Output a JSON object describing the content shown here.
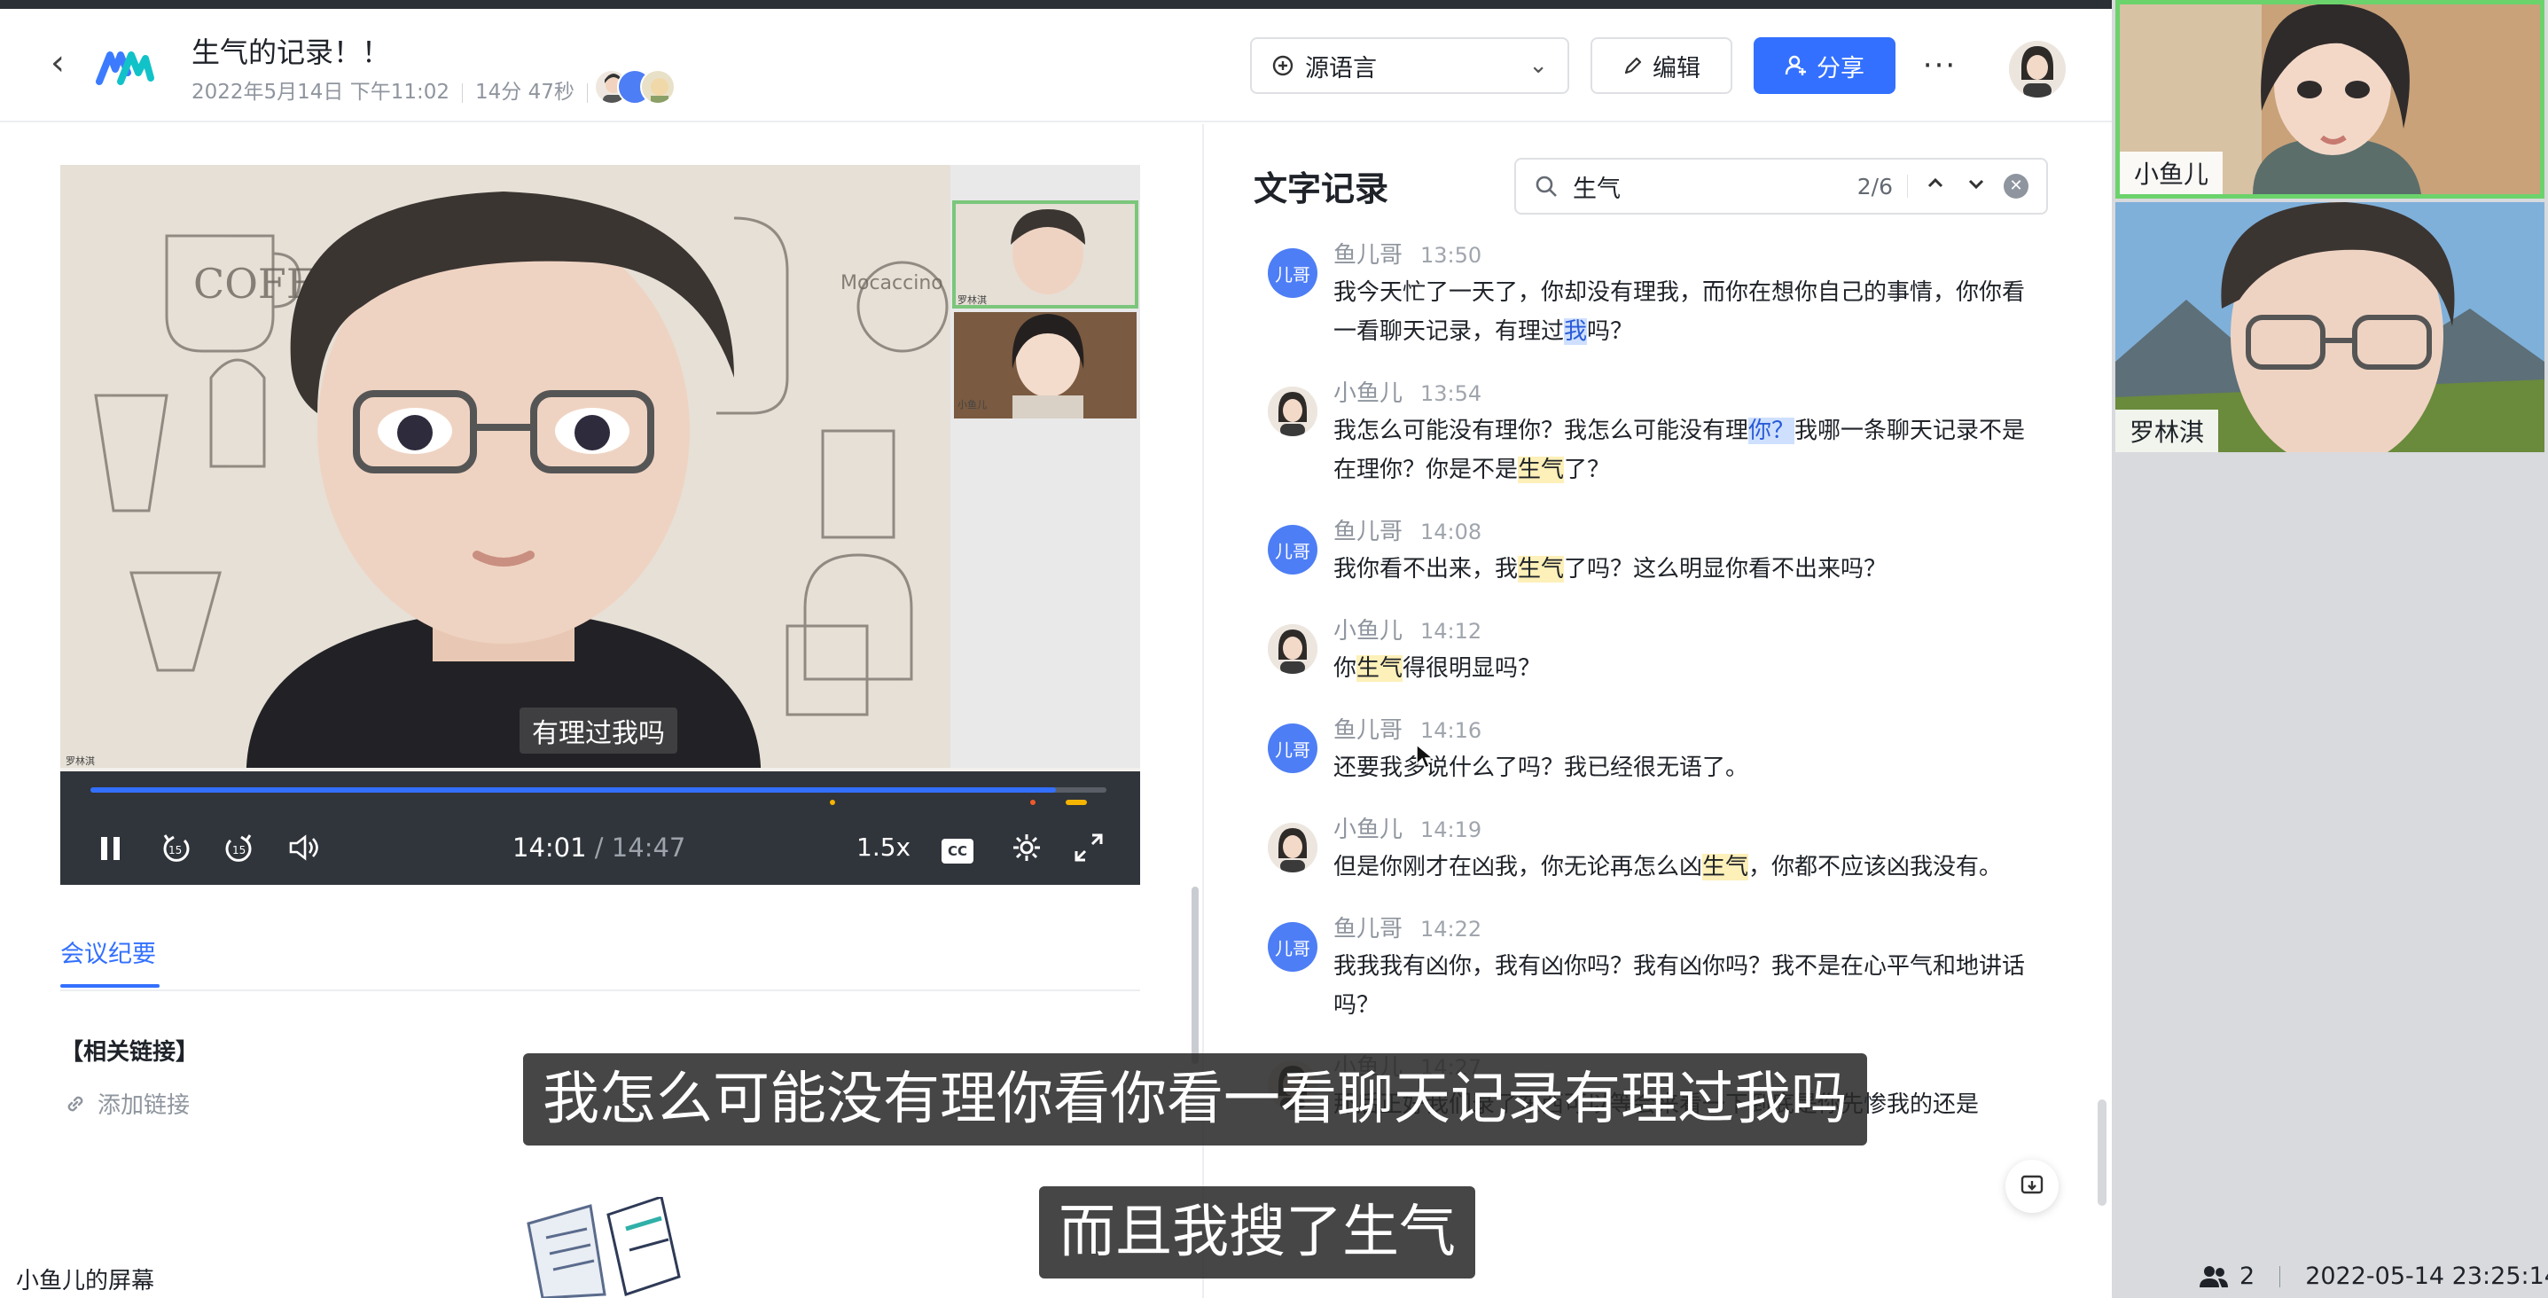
{
  "header": {
    "title": "生气的记录！！",
    "date": "2022年5月14日 下午11:02",
    "duration": "14分 47秒",
    "language_select": "源语言",
    "edit_label": "编辑",
    "share_label": "分享",
    "more_label": "···",
    "accent": "#3370ff"
  },
  "video": {
    "caption": "有理过我吗",
    "current_time": "14:01",
    "separator": "/",
    "total_time": "14:47",
    "speed": "1.5x",
    "cc_label": "CC",
    "progress": 0.95,
    "main_name": "罗林淇",
    "cam_name_1": "罗林淇",
    "cam_name_2": "小鱼儿"
  },
  "summary": {
    "tab_label": "会议纪要",
    "section_title": "【相关链接】",
    "add_link": "添加链接"
  },
  "screen_label": "小鱼儿的屏幕",
  "transcript": {
    "title": "文字记录",
    "search_value": "生气",
    "search_count": "2/6",
    "messages": [
      {
        "speaker": "鱼儿哥",
        "time": "13:50",
        "avatar": "儿哥",
        "segments": [
          {
            "t": "我今天忙了一天了，你却没有理我，而你在想你自己的事情，你你看一看聊天记录，有理过"
          },
          {
            "t": "我",
            "hl": "b"
          },
          {
            "t": "吗？"
          }
        ]
      },
      {
        "speaker": "小鱼儿",
        "time": "13:54",
        "avatar": "",
        "segments": [
          {
            "t": "我怎么可能没有理你？我怎么可能没有理"
          },
          {
            "t": "你？",
            "hl": "b"
          },
          {
            "t": "我哪一条聊天记录不是在理你？你是不是"
          },
          {
            "t": "生气",
            "hl": "y"
          },
          {
            "t": "了？"
          }
        ]
      },
      {
        "speaker": "鱼儿哥",
        "time": "14:08",
        "avatar": "儿哥",
        "segments": [
          {
            "t": "我你看不出来，我"
          },
          {
            "t": "生气",
            "hl": "y"
          },
          {
            "t": "了吗？这么明显你看不出来吗？"
          }
        ]
      },
      {
        "speaker": "小鱼儿",
        "time": "14:12",
        "avatar": "",
        "segments": [
          {
            "t": "你"
          },
          {
            "t": "生气",
            "hl": "y"
          },
          {
            "t": "得很明显吗？"
          }
        ]
      },
      {
        "speaker": "鱼儿哥",
        "time": "14:16",
        "avatar": "儿哥",
        "segments": [
          {
            "t": "还要我多说什么了吗？我已经很无语了。"
          }
        ]
      },
      {
        "speaker": "小鱼儿",
        "time": "14:19",
        "avatar": "",
        "segments": [
          {
            "t": "但是你刚才在凶我，你无论再怎么凶"
          },
          {
            "t": "生气",
            "hl": "y"
          },
          {
            "t": "，你都不应该凶我没有。"
          }
        ]
      },
      {
        "speaker": "鱼儿哥",
        "time": "14:22",
        "avatar": "儿哥",
        "segments": [
          {
            "t": "我我我有凶你，我有凶你吗？我有凶你吗？我不是在心平气和地讲话吗？"
          }
        ]
      },
      {
        "speaker": "小鱼儿",
        "time": "14:27",
        "avatar": "",
        "segments": [
          {
            "t": "那后正好我们录了东西可以等会来看一下到底是你先惨我的还是"
          }
        ]
      }
    ]
  },
  "subtitles": {
    "line1": "我怎么可能没有理你看你看一看聊天记录有理过我吗",
    "line2": "而且我搜了生气"
  },
  "gallery": {
    "tile1_name": "小鱼儿",
    "tile2_name": "罗林淇"
  },
  "status": {
    "participants": "2",
    "datetime": "2022-05-14 23:25:14"
  }
}
